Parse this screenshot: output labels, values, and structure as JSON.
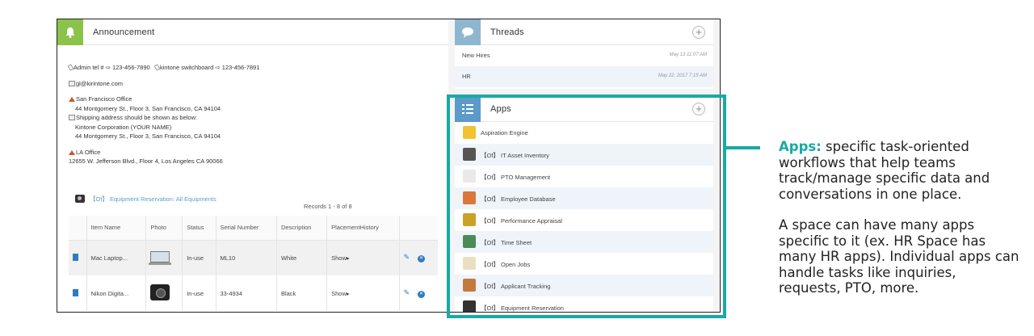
{
  "announcement": {
    "title": "Announcement",
    "lines": [
      "Admin tel # ⇨ 123-456-7890",
      "kintone switchboard ⇨ 123-456-7891",
      "gl@kirintone.com",
      "San Francisco Office",
      "44 Montgomery St., Floor 3, San Francisco, CA 94104",
      "Shipping address should be shown as below:",
      "Kintone Corporation (YOUR NAME)",
      "44 Montgomery St., Floor 3, San Francisco, CA 94104",
      "LA Office",
      "12655 W. Jefferson Blvd., Floor 4, Los Angeles CA 90066"
    ],
    "embedded_app_link": "【Of】 Equipment Reservation: All Equipments",
    "records": "Records 1 - 8  of 8",
    "table": {
      "headers": [
        "Item Name",
        "Photo",
        "Status",
        "Serial Number",
        "Description",
        "PlacementHistory"
      ],
      "rows": [
        {
          "item": "Mac Laptop...",
          "status": "In-use",
          "serial": "ML10",
          "description": "White",
          "history": "Show▸"
        },
        {
          "item": "Nikon Digita...",
          "status": "In-use",
          "serial": "33-4934",
          "description": "Black",
          "history": "Show▸"
        }
      ]
    }
  },
  "threads": {
    "title": "Threads",
    "plus": "+",
    "items": [
      {
        "name": "New Hires",
        "date": "May 13 11:07 AM"
      },
      {
        "name": "HR",
        "date": "May 22, 2017 7:15 AM"
      }
    ]
  },
  "apps": {
    "title": "Apps",
    "plus": "+",
    "items": [
      {
        "label": "Aspiration Engine",
        "icon": "lightbulb-icon",
        "color": "#f2c230"
      },
      {
        "label": "【Of】 IT Asset Inventory",
        "icon": "hard-drive-icon",
        "color": "#555555"
      },
      {
        "label": "【Of】 PTO Management",
        "icon": "calendar-icon",
        "color": "#e9e9e9"
      },
      {
        "label": "【Of】 Employee Database",
        "icon": "binders-icon",
        "color": "#d9783a"
      },
      {
        "label": "【Of】 Performance Appraisal",
        "icon": "trophy-icon",
        "color": "#c9a227"
      },
      {
        "label": "【Of】 Time Sheet",
        "icon": "clock-icon",
        "color": "#4c8a5a"
      },
      {
        "label": "【Of】 Open Jobs",
        "icon": "clipboard-icon",
        "color": "#eadfc0"
      },
      {
        "label": "【Of】 Applicant Tracking",
        "icon": "person-icon",
        "color": "#c27a3d"
      },
      {
        "label": "【Of】 Equipment Reservation",
        "icon": "camera-icon",
        "color": "#333333"
      }
    ]
  },
  "callout": {
    "keyword": "Apps:",
    "text1": " specific task-oriented workflows that help teams track/manage specific data and conversations in one place.",
    "text2": "A space can have many apps specific to it (ex. HR Space has many HR apps). Individual apps can handle tasks like inquiries, requests, PTO, more."
  },
  "colors": {
    "accent": "#17aaa6",
    "announcement_icon_bg": "#8bc34a",
    "threads_icon_bg": "#8fb6cf",
    "apps_icon_bg": "#5b9ac9",
    "link": "#5aa0c8"
  }
}
